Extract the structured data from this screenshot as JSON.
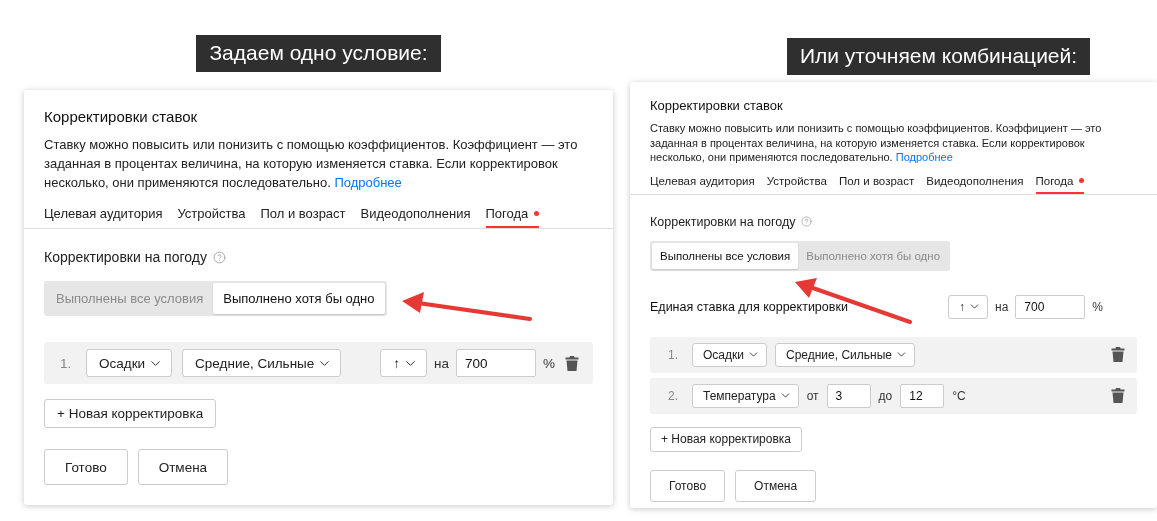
{
  "panels": [
    {
      "caption": "Задаем одно условие:",
      "title": "Корректировки ставок",
      "description": "Ставку можно повысить или понизить с помощью коэффициентов. Коэффициент — это заданная в процентах величина, на которую изменяется ставка. Если корректировок несколько, они применяются последовательно.",
      "link": "Подробнее",
      "tabs": [
        {
          "label": "Целевая аудитория",
          "selected": false,
          "marked": false
        },
        {
          "label": "Устройства",
          "selected": false,
          "marked": false
        },
        {
          "label": "Пол и возраст",
          "selected": false,
          "marked": false
        },
        {
          "label": "Видеодополнения",
          "selected": false,
          "marked": false
        },
        {
          "label": "Погода",
          "selected": true,
          "marked": true
        }
      ],
      "section_title": "Корректировки на погоду",
      "toggle": [
        {
          "label": "Выполнены все условия",
          "selected": false
        },
        {
          "label": "Выполнено хотя бы одно",
          "selected": true
        }
      ],
      "conditions": [
        {
          "kind": "choice",
          "number": "1.",
          "selects": [
            "Осадки",
            "Средние, Сильные"
          ],
          "rate": {
            "direction": "↑",
            "preposition": "на",
            "value": "700",
            "unit": "%"
          }
        }
      ],
      "add_button": "+ Новая корректировка",
      "buttons": [
        "Готово",
        "Отмена"
      ]
    },
    {
      "caption": "Или уточняем комбинацией:",
      "title": "Корректировки ставок",
      "description": "Ставку можно повысить или понизить с помощью коэффициентов. Коэффициент — это заданная в процентах величина, на которую изменяется ставка. Если корректировок несколько, они применяются последовательно.",
      "link": "Подробнее",
      "tabs": [
        {
          "label": "Целевая аудитория",
          "selected": false,
          "marked": false
        },
        {
          "label": "Устройства",
          "selected": false,
          "marked": false
        },
        {
          "label": "Пол и возраст",
          "selected": false,
          "marked": false
        },
        {
          "label": "Видеодополнения",
          "selected": false,
          "marked": false
        },
        {
          "label": "Погода",
          "selected": true,
          "marked": true
        }
      ],
      "section_title": "Корректировки на погоду",
      "toggle": [
        {
          "label": "Выполнены все условия",
          "selected": true
        },
        {
          "label": "Выполнено хотя бы одно",
          "selected": false
        }
      ],
      "unified_rate": {
        "label": "Единая ставка для корректировки",
        "direction": "↑",
        "preposition": "на",
        "value": "700",
        "unit": "%"
      },
      "conditions": [
        {
          "kind": "choice",
          "number": "1.",
          "selects": [
            "Осадки",
            "Средние, Сильные"
          ]
        },
        {
          "kind": "range",
          "number": "2.",
          "selects": [
            "Температура"
          ],
          "from_label": "от",
          "from": "3",
          "to_label": "до",
          "to": "12",
          "unit": "°C"
        }
      ],
      "add_button": "+ Новая корректировка",
      "buttons": [
        "Готово",
        "Отмена"
      ]
    }
  ]
}
